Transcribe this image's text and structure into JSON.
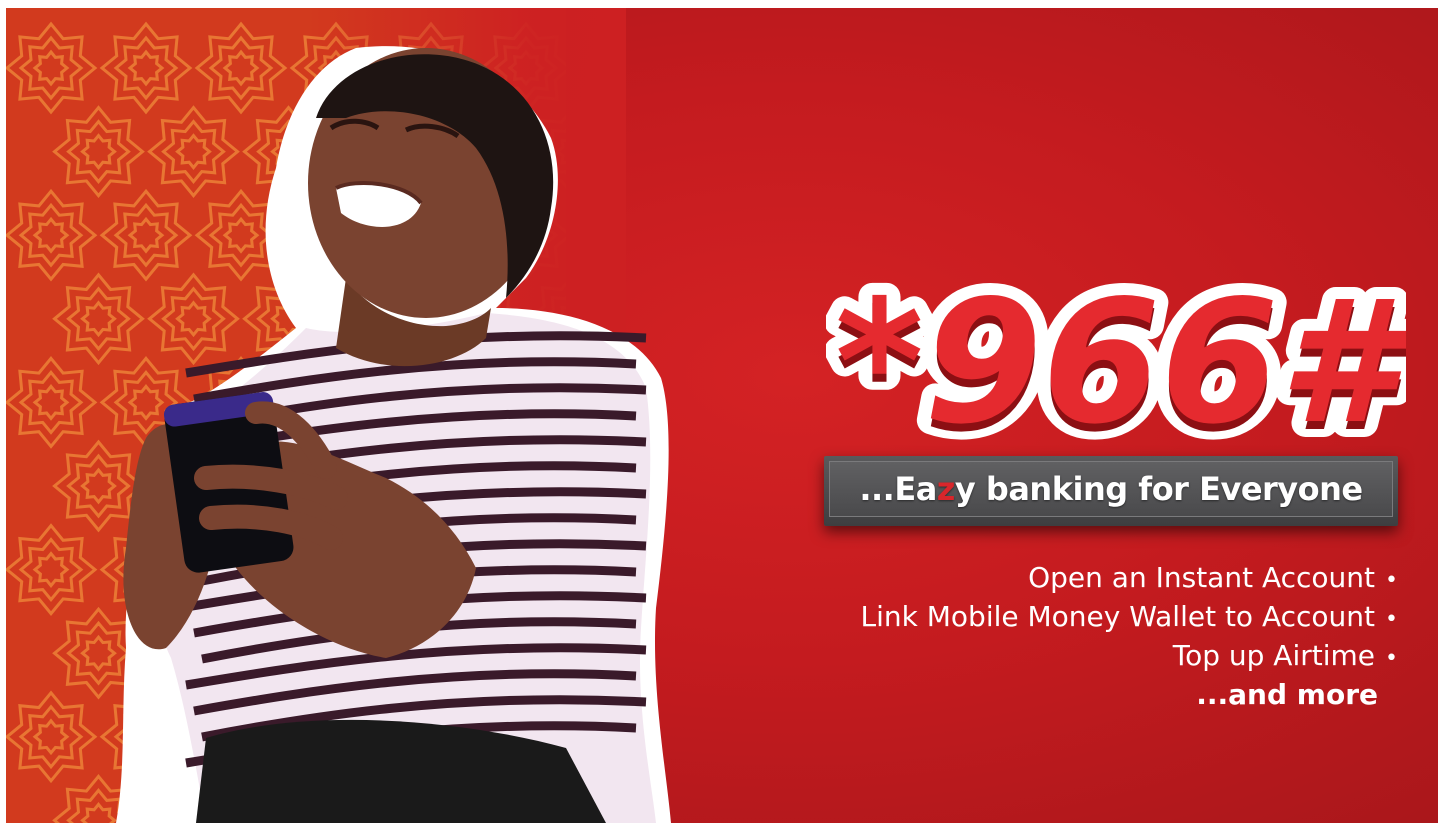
{
  "banner": {
    "code": "*966#",
    "tagline_prefix": "...Ea",
    "tagline_z": "z",
    "tagline_suffix": "y banking for Everyone",
    "features": [
      "Open an Instant Account",
      "Link Mobile Money Wallet to Account",
      "Top up Airtime"
    ],
    "bullet": "•",
    "more": "...and more"
  },
  "colors": {
    "brand_red": "#d42224",
    "tagline_box": "#4a4a4c",
    "text": "#ffffff"
  },
  "icons": {
    "pattern": "geometric-star-pattern",
    "photo": "smiling-woman-with-phone"
  }
}
